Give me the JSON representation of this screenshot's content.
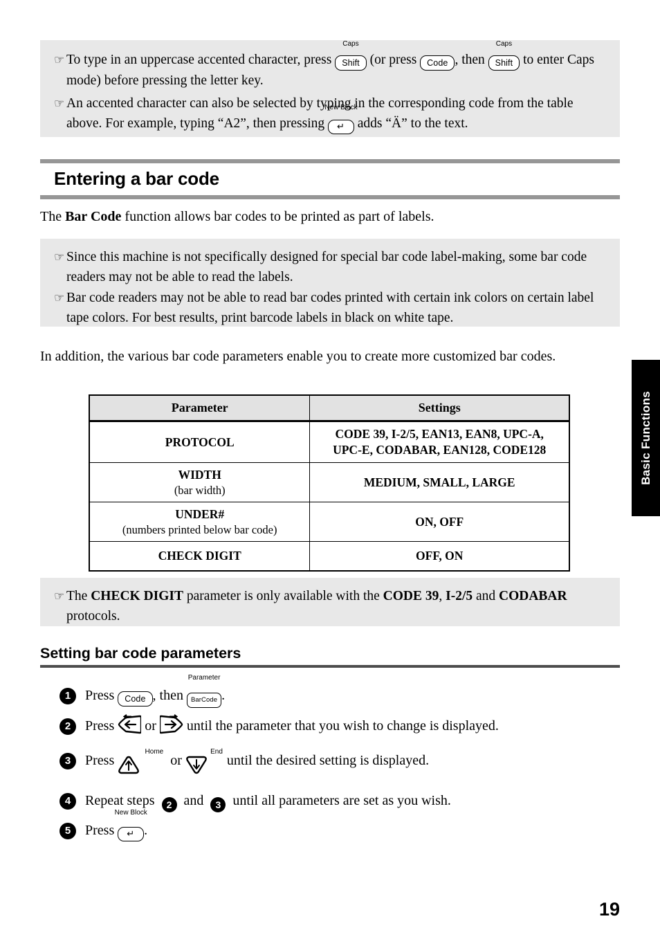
{
  "top_note": {
    "bullet_glyph": "☞",
    "items": [
      {
        "before": "To type in an uppercase accented character, press",
        "key1": {
          "label": "Shift",
          "top": "Caps"
        },
        "middle1": "(or press",
        "key2": {
          "label": "Code",
          "top": ""
        },
        "middle2": ", then",
        "key3": {
          "label": "Shift",
          "top": "Caps"
        },
        "after": "to enter Caps mode) before pressing the letter key."
      },
      {
        "before": "An accented character can also be selected by typing in the corresponding code from the table above. For example, typing “A2”, then pressing",
        "key1": {
          "label": "↵",
          "top": "New Block"
        },
        "after": "adds “Ä” to the text."
      }
    ]
  },
  "section": {
    "heading": "Entering a bar code",
    "intro_before": "The ",
    "intro_bold": "Bar Code",
    "intro_after": " function allows bar codes to be printed as part of labels."
  },
  "barcode_note": {
    "bullet_glyph": "☞",
    "items": [
      "Since this machine is not specifically designed for special bar code label-making, some bar code readers may not be able to read the labels.",
      "Bar code readers may not be able to read bar codes printed with certain ink colors on certain label tape colors. For best results, print barcode labels in black on white tape."
    ]
  },
  "paragraph": "In addition, the various bar code parameters enable you to create more customized bar codes.",
  "table": {
    "headers": [
      "Parameter",
      "Settings"
    ],
    "rows": [
      {
        "parameter": "PROTOCOL",
        "parameter_sub": "",
        "settings_line1": "CODE 39, I-2/5, EAN13, EAN8, UPC-A,",
        "settings_line2": "UPC-E, CODABAR, EAN128, CODE128"
      },
      {
        "parameter": "WIDTH",
        "parameter_sub": "(bar width)",
        "settings_line1": "MEDIUM, SMALL, LARGE",
        "settings_line2": ""
      },
      {
        "parameter": "UNDER#",
        "parameter_sub": "(numbers printed below bar code)",
        "settings_line1": "ON, OFF",
        "settings_line2": ""
      },
      {
        "parameter": "CHECK DIGIT",
        "parameter_sub": "",
        "settings_line1": "OFF, ON",
        "settings_line2": ""
      }
    ]
  },
  "checkdigit_note": {
    "bullet_glyph": "☞",
    "part1": "The ",
    "bold1": "CHECK DIGIT",
    "part2": " parameter is only available with the ",
    "bold2": "CODE 39",
    "part3": ", ",
    "bold3": "I-2/5",
    "part4": " and ",
    "bold4": "CODABAR",
    "part5": " protocols."
  },
  "subsection": {
    "heading": "Setting bar code parameters"
  },
  "steps": [
    {
      "number": "1",
      "text_before": "Press",
      "key1": {
        "label": "Code",
        "top": ""
      },
      "text_mid": ", then",
      "key2": {
        "label": "BarCode",
        "top": "Parameter"
      },
      "text_after": "."
    },
    {
      "number": "2",
      "text_before": "Press",
      "key_left": "left-arrow-key",
      "text_mid": "or",
      "key_right": "right-arrow-key",
      "text_after": "until the parameter that you wish to change is displayed."
    },
    {
      "number": "3",
      "text_before": "Press",
      "key_up": {
        "top": "Home"
      },
      "text_mid": "or",
      "key_down": {
        "top": "End"
      },
      "text_after": "until the desired setting is displayed."
    },
    {
      "number": "4",
      "text_before": "Repeat steps",
      "ref1": "2",
      "text_mid": "and",
      "ref2": "3",
      "text_after": "until all parameters are set as you wish."
    },
    {
      "number": "5",
      "text_before": "Press",
      "key1": {
        "label": "↵",
        "top": "New Block"
      },
      "text_after": "."
    }
  ],
  "side_tab": {
    "label": "Basic Functions"
  },
  "page_number": "19",
  "colors": {
    "note_bg": "#e8e8e8",
    "heading_bar": "#969696",
    "subheading_rule": "#4d4d4d",
    "table_header_bg": "#e2e2e2",
    "tab_bg": "#000000"
  }
}
